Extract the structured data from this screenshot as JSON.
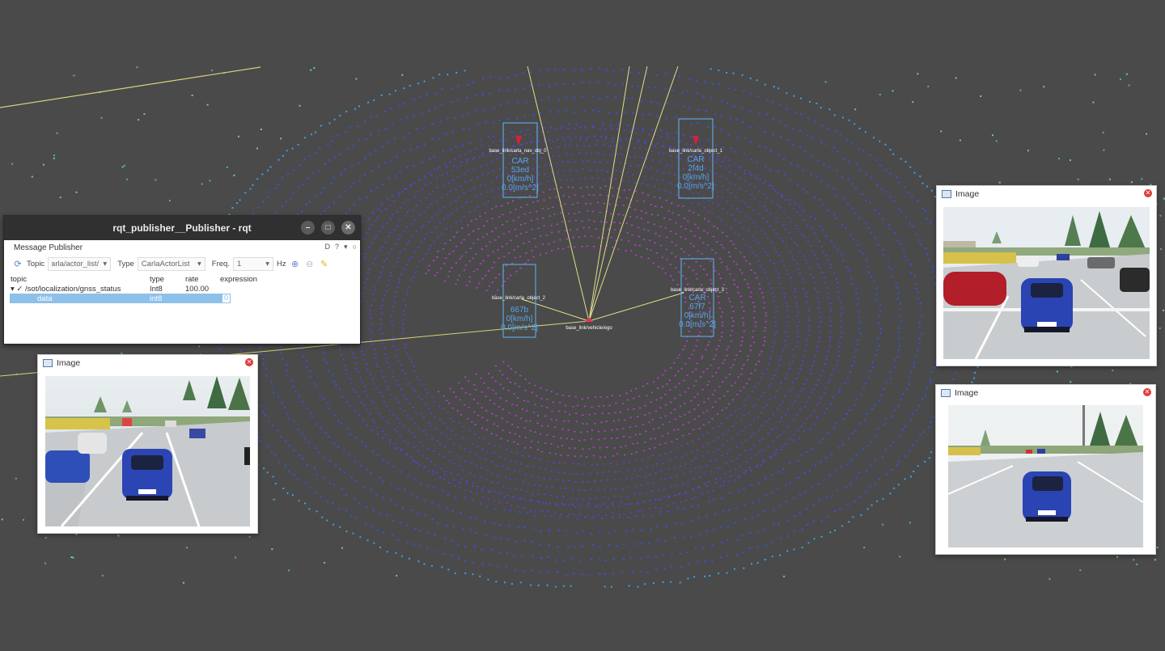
{
  "objects": [
    {
      "frame": "base_link/carla_nav_obj_0",
      "class": "CAR",
      "id": "53ed",
      "speed": "0[km/h]",
      "accel": "0.0[m/s^2]"
    },
    {
      "frame": "base_link/carla_object_1",
      "class": "CAR",
      "id": "2f4d",
      "speed": "0[km/h]",
      "accel": "0.0[m/s^2]"
    },
    {
      "frame": "base_link/carla_object_2",
      "class": "CAR",
      "id": "667b",
      "speed": "0[km/h]",
      "accel": "0.0[m/s^2]"
    },
    {
      "frame": "base_link/carla_object_3",
      "class": "CAR",
      "id": "67f7",
      "speed": "0[km/h]",
      "accel": "0.0[m/s^2]"
    }
  ],
  "ego_label": "base_link/vehicle/ego",
  "rqt": {
    "title": "rqt_publisher__Publisher - rqt",
    "plugin": "Message Publisher",
    "plugin_right": "D",
    "toolbar": {
      "topic_label": "Topic",
      "topic_value": "/carla/actor_list",
      "type_label": "Type",
      "type_value": "CarlaActorList",
      "freq_label": "Freq.",
      "freq_value": "1",
      "hz_label": "Hz"
    },
    "columns": [
      "topic",
      "type",
      "rate",
      "expression"
    ],
    "rows": [
      {
        "topic": "/sot/localization/gnss_status",
        "type": "Int8",
        "rate": "100.00",
        "expression": ""
      },
      {
        "topic": "data",
        "type": "int8",
        "rate": "",
        "expression": "0"
      }
    ]
  },
  "image_windows": [
    {
      "title": "Image"
    },
    {
      "title": "Image"
    },
    {
      "title": "Image"
    }
  ]
}
